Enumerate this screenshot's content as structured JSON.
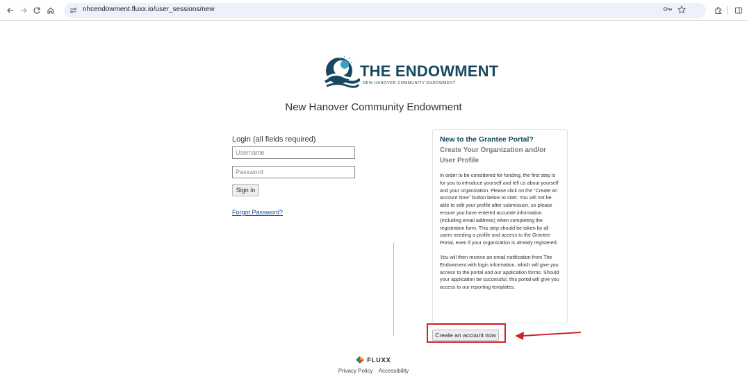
{
  "browser": {
    "url": "nhcendowment.fluxx.io/user_sessions/new",
    "icons": {
      "back": "back-arrow-icon",
      "forward": "forward-arrow-icon",
      "reload": "reload-icon",
      "home": "home-icon",
      "site_settings": "tune-icon",
      "password": "key-icon",
      "bookmark": "star-icon",
      "extensions": "puzzle-icon",
      "side_panel": "side-panel-icon"
    }
  },
  "logo": {
    "title": "THE ENDOWMENT",
    "subtitle": "NEW HANOVER COMMUNITY ENDOWMENT",
    "colors": {
      "primary": "#16495f",
      "accent": "#3aa0c8"
    }
  },
  "org_name": "New Hanover Community Endowment",
  "login": {
    "heading": "Login (all fields required)",
    "username_placeholder": "Username",
    "password_placeholder": "Password",
    "sign_in_label": "Sign in",
    "forgot_label": "Forgot Password?"
  },
  "panel": {
    "title": "New to the Grantee Portal?",
    "subtitle": "Create Your Organization and/or User Profile",
    "paragraph1": "In order to be considered for funding, the first step is for you to introduce yourself and tell us about yourself and your organization. Please click on the \"Create an account Now\" button below to start. You will not be able to edit your profile after submission, so please ensure you have entered accurate information (including email address) when completing the registration form. This step should be taken by all users needing a profile and access to the Grantee Portal, even if your organization is already registered.",
    "paragraph2": "You will then receive an email notification from The Endowment with login information, which will give you access to the portal and our application forms. Should your application be successful, this portal will give you access to our reporting templates.",
    "create_label": "Create an account now"
  },
  "annotation": {
    "highlight_color": "#d32026"
  },
  "footer": {
    "brand": "FLUXX",
    "links": [
      "Privacy Policy",
      "Accessibility"
    ]
  }
}
